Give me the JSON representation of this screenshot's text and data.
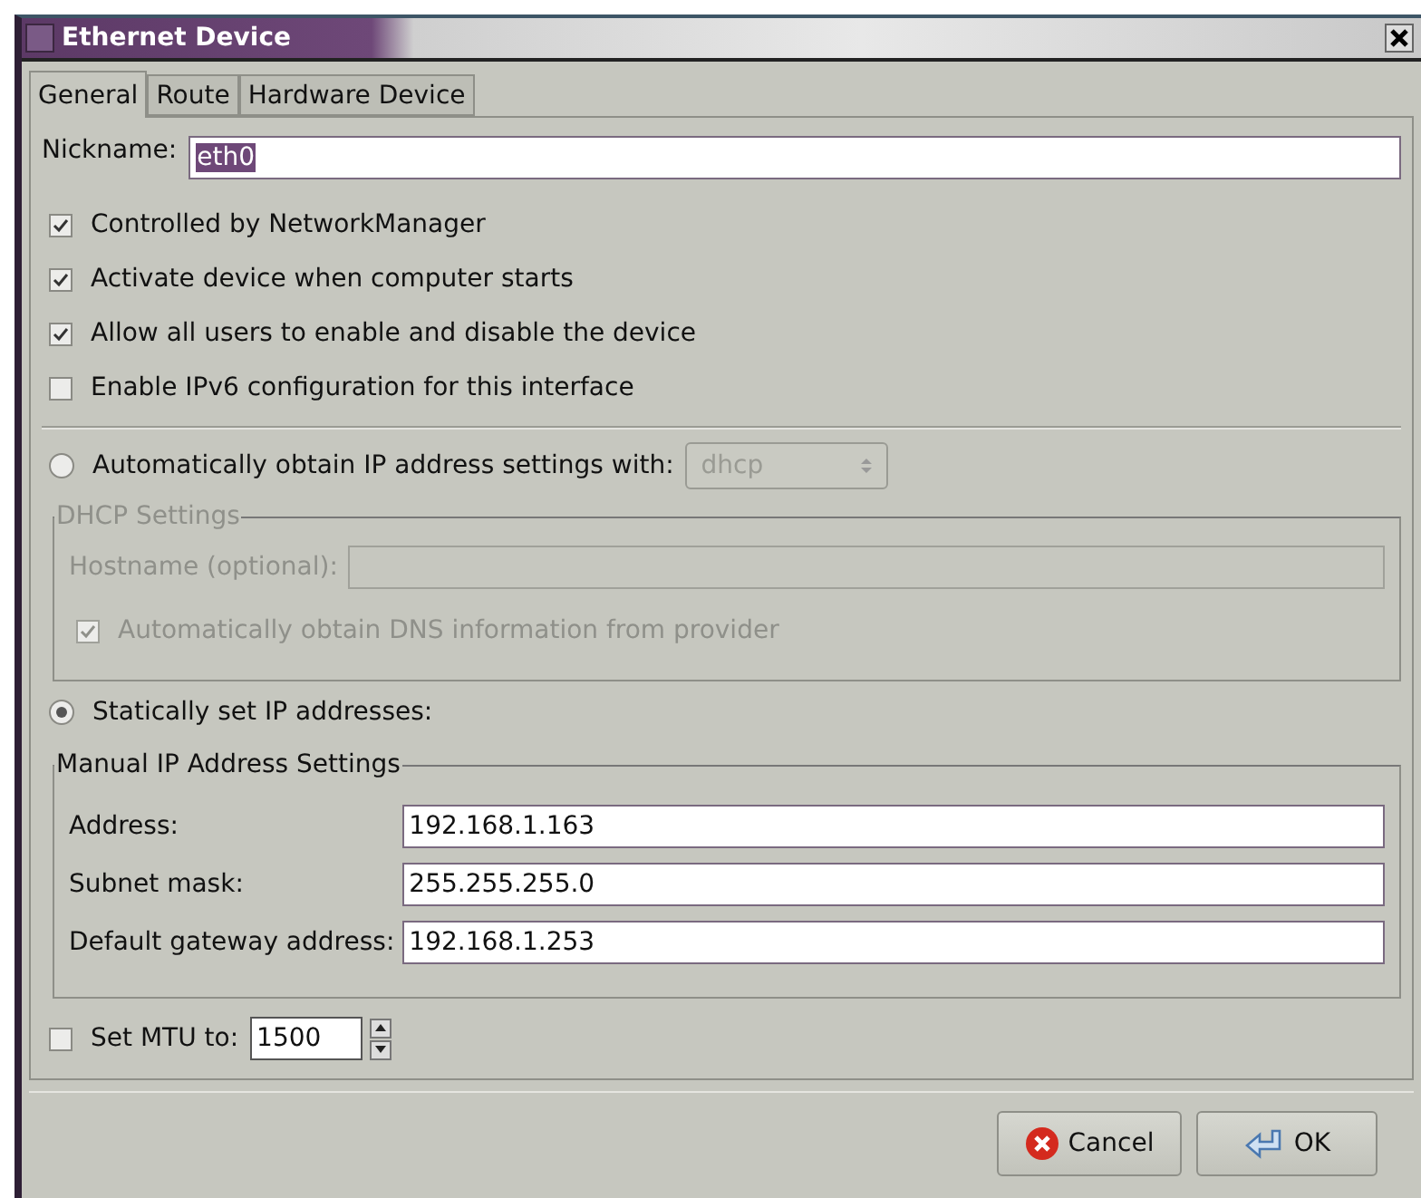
{
  "window": {
    "title": "Ethernet Device"
  },
  "tabs": [
    {
      "label": "General",
      "selected": true
    },
    {
      "label": "Route",
      "selected": false
    },
    {
      "label": "Hardware Device",
      "selected": false
    }
  ],
  "nickname": {
    "label": "Nickname:",
    "value": "eth0",
    "selected": true
  },
  "options": [
    {
      "label": "Controlled by NetworkManager",
      "checked": true
    },
    {
      "label": "Activate device when computer starts",
      "checked": true
    },
    {
      "label": "Allow all users to enable and disable the device",
      "checked": true
    },
    {
      "label": "Enable IPv6 configuration for this interface",
      "checked": false
    }
  ],
  "auto_ip": {
    "label": "Automatically obtain IP address settings with:",
    "selected": false,
    "protocol": "dhcp",
    "disabled": true
  },
  "dhcp_settings": {
    "title": "DHCP Settings",
    "disabled": true,
    "hostname_label": "Hostname (optional):",
    "dns": {
      "label": "Automatically obtain DNS information from provider",
      "checked": true
    }
  },
  "static_ip": {
    "label": "Statically set IP addresses:",
    "selected": true
  },
  "manual_settings": {
    "title": "Manual IP Address Settings",
    "fields": [
      {
        "label": "Address:",
        "value": "192.168.1.163"
      },
      {
        "label": "Subnet mask:",
        "value": "255.255.255.0"
      },
      {
        "label": "Default gateway address:",
        "value": "192.168.1.253"
      }
    ]
  },
  "mtu": {
    "label": "Set MTU to:",
    "checked": false,
    "value": "1500"
  },
  "buttons": [
    {
      "label": "Cancel",
      "kind": "cancel"
    },
    {
      "label": "OK",
      "kind": "ok"
    }
  ]
}
